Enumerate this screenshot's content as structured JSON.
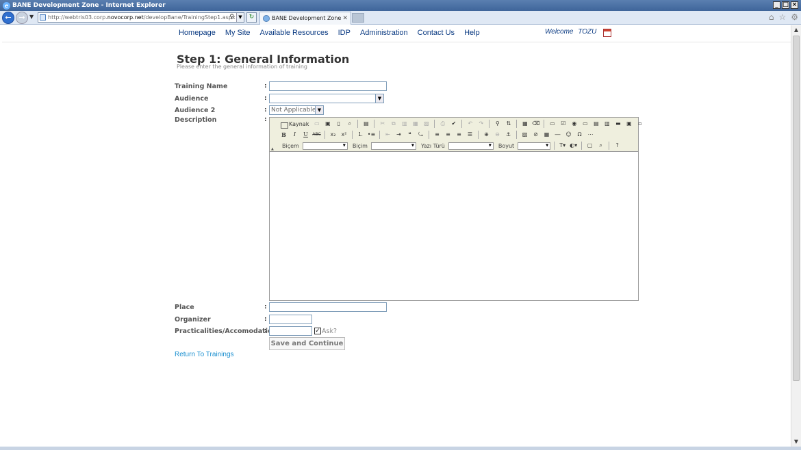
{
  "browser": {
    "window_title": "BANE Development Zone - Internet Explorer",
    "url_prefix": "http://webtris03.corp.",
    "url_host": "novocorp.net",
    "url_path": "/developBane/TrainingStep1.aspx",
    "tab_title": "BANE Development Zone",
    "tab_close": "✕"
  },
  "nav": {
    "items": [
      "Homepage",
      "My Site",
      "Available Resources",
      "IDP",
      "Administration",
      "Contact Us",
      "Help"
    ],
    "welcome_label": "Welcome",
    "user_name": "TOZU"
  },
  "form": {
    "title": "Step 1: General Information",
    "subtitle": "Please enter the general information of training",
    "colon": ":",
    "training_name_label": "Training Name",
    "audience_label": "Audience",
    "audience_value": "",
    "audience2_label": "Audience 2",
    "audience2_value": "Not Applicable",
    "description_label": "Description",
    "place_label": "Place",
    "organizer_label": "Organizer",
    "practicalities_label": "Practicalities/Accomodation",
    "ask_label": "Ask?",
    "ask_checked": true,
    "save_button": "Save and Continue",
    "return_link": "Return To Trainings"
  },
  "editor": {
    "source_label": "Kaynak",
    "format_label": "Biçem",
    "paragraph_label": "Biçim",
    "font_label": "Yazı Türü",
    "size_label": "Boyut"
  }
}
